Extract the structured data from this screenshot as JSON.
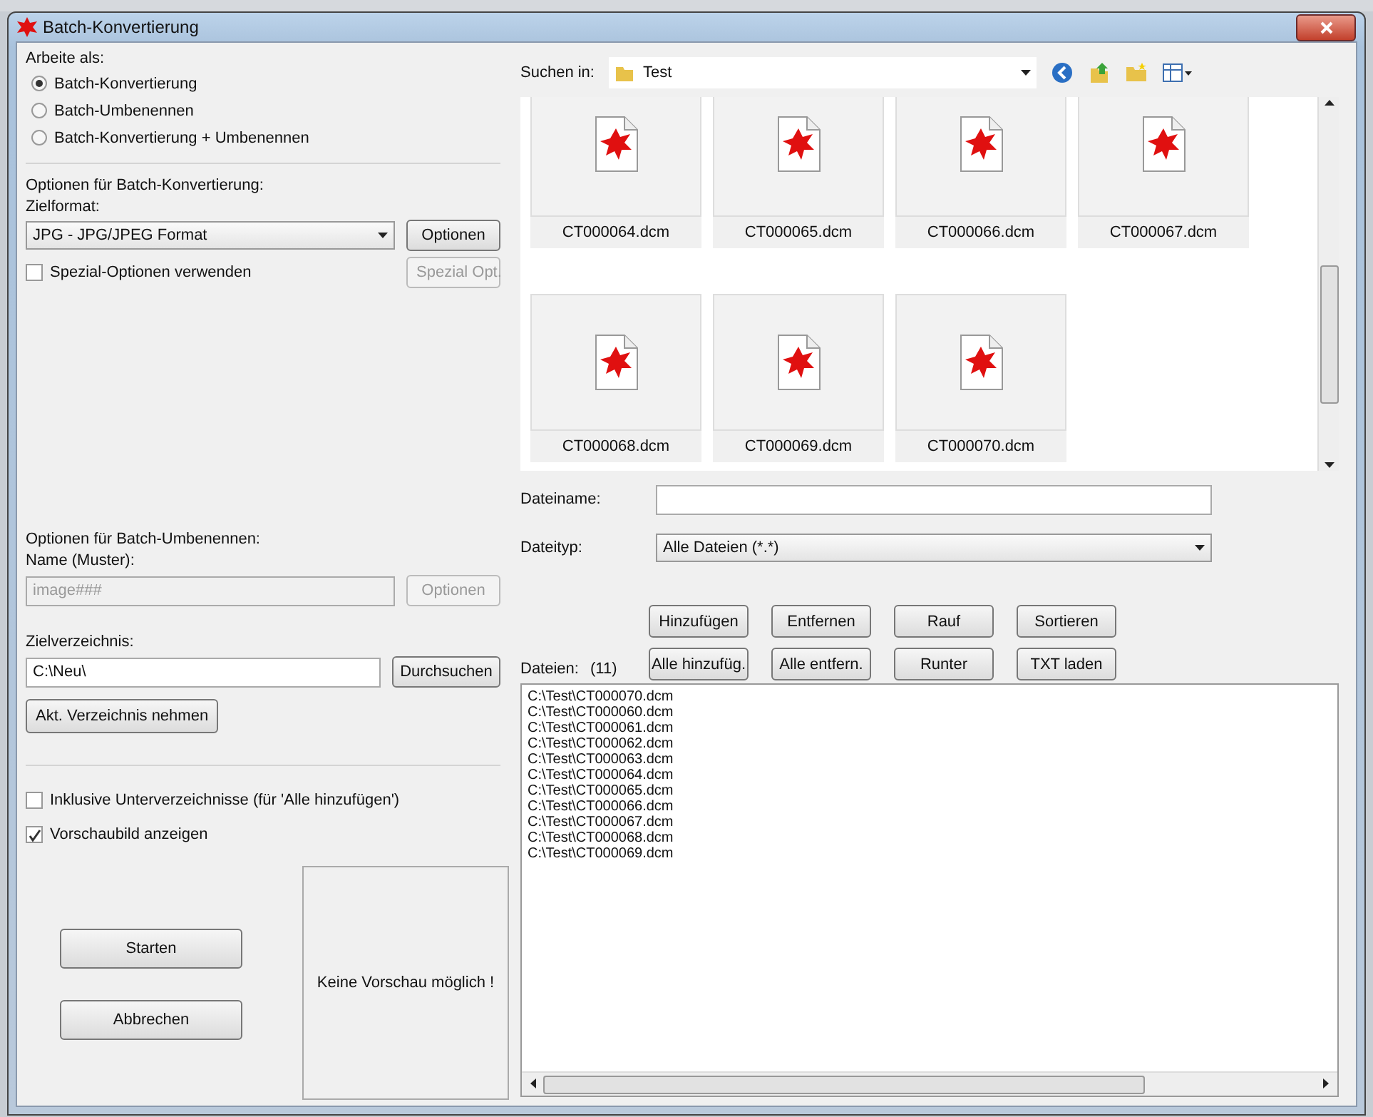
{
  "window": {
    "title": "Batch-Konvertierung"
  },
  "work_as": {
    "label": "Arbeite als:",
    "options": [
      {
        "label": "Batch-Konvertierung",
        "selected": true
      },
      {
        "label": "Batch-Umbenennen",
        "selected": false
      },
      {
        "label": "Batch-Konvertierung + Umbenennen",
        "selected": false
      }
    ]
  },
  "conversion": {
    "heading": "Optionen für Batch-Konvertierung:",
    "format_label": "Zielformat:",
    "format": "JPG - JPG/JPEG Format",
    "options_button": {
      "label": "Optionen",
      "disabled": false
    },
    "special": {
      "label": "Spezial-Optionen verwenden",
      "checked": false
    },
    "special_button": {
      "label": "Spezial Opt.",
      "disabled": true
    }
  },
  "rename": {
    "heading": "Optionen für Batch-Umbenennen:",
    "name_label": "Name (Muster):",
    "name_value": "image###",
    "name_disabled": true,
    "options_button": {
      "label": "Optionen",
      "disabled": true
    }
  },
  "target": {
    "label": "Zielverzeichnis:",
    "value": "C:\\Neu\\",
    "browse": "Durchsuchen",
    "current_dir": "Akt. Verzeichnis nehmen"
  },
  "checkboxes": [
    {
      "label": "Inklusive Unterverzeichnisse (für 'Alle hinzufügen')",
      "checked": false
    },
    {
      "label": "Vorschaubild anzeigen",
      "checked": true
    }
  ],
  "actions": [
    "Starten",
    "Abbrechen"
  ],
  "preview": {
    "text": "Keine Vorschau möglich !"
  },
  "browser": {
    "look_in_label": "Suchen in:",
    "folder": "Test",
    "files": [
      {
        "name": "CT000064.dcm"
      },
      {
        "name": "CT000065.dcm"
      },
      {
        "name": "CT000066.dcm"
      },
      {
        "name": "CT000067.dcm"
      },
      {
        "name": "CT000068.dcm"
      },
      {
        "name": "CT000069.dcm"
      },
      {
        "name": "CT000070.dcm"
      }
    ],
    "filename_label": "Dateiname:",
    "filetype_label": "Dateityp:",
    "filetype": "Alle Dateien (*.*)"
  },
  "list_buttons": [
    "Hinzufügen",
    "Entfernen",
    "Rauf",
    "Sortieren",
    "Alle hinzufüg.",
    "Alle entfern.",
    "Runter",
    "TXT laden"
  ],
  "files": {
    "label": "Dateien:",
    "count": "(11)",
    "items": [
      "C:\\Test\\CT000070.dcm",
      "C:\\Test\\CT000060.dcm",
      "C:\\Test\\CT000061.dcm",
      "C:\\Test\\CT000062.dcm",
      "C:\\Test\\CT000063.dcm",
      "C:\\Test\\CT000064.dcm",
      "C:\\Test\\CT000065.dcm",
      "C:\\Test\\CT000066.dcm",
      "C:\\Test\\CT000067.dcm",
      "C:\\Test\\CT000068.dcm",
      "C:\\Test\\CT000069.dcm"
    ]
  }
}
